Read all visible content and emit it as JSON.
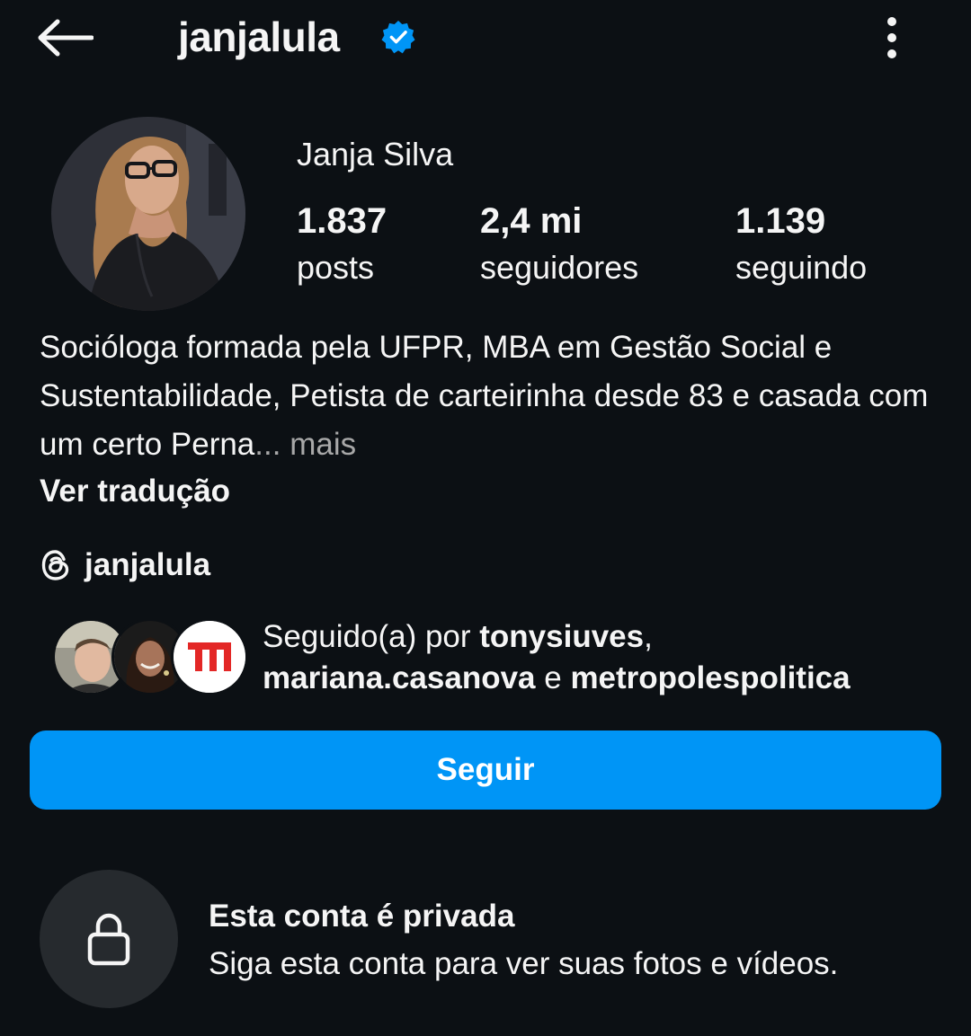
{
  "header": {
    "username": "janjalula",
    "verified": true,
    "back_icon": "arrow-left-icon",
    "more_icon": "more-vertical-icon"
  },
  "profile": {
    "full_name": "Janja Silva",
    "stats": {
      "posts": {
        "value": "1.837",
        "label": "posts"
      },
      "followers": {
        "value": "2,4 mi",
        "label": "seguidores"
      },
      "following": {
        "value": "1.139",
        "label": "seguindo"
      }
    },
    "bio": "Socióloga formada pela UFPR, MBA em Gestão Social e Sustentabilidade, Petista de carteirinha desde 83 e casada com um certo Perna",
    "bio_ellipsis": "...",
    "bio_more": " mais",
    "translate_label": "Ver tradução",
    "threads_handle": "janjalula"
  },
  "followed_by": {
    "prefix": "Seguido(a) por ",
    "user1": "tonysiuves",
    "sep1": ", ",
    "user2": "mariana.casanova",
    "sep2": " e ",
    "user3": "metropolespolitica"
  },
  "follow_button": {
    "label": "Seguir"
  },
  "private_notice": {
    "title": "Esta conta é privada",
    "subtitle": "Siga esta conta para ver suas fotos e vídeos."
  },
  "colors": {
    "background": "#0c1014",
    "accent": "#0095f6",
    "muted": "#a8a8a8"
  }
}
